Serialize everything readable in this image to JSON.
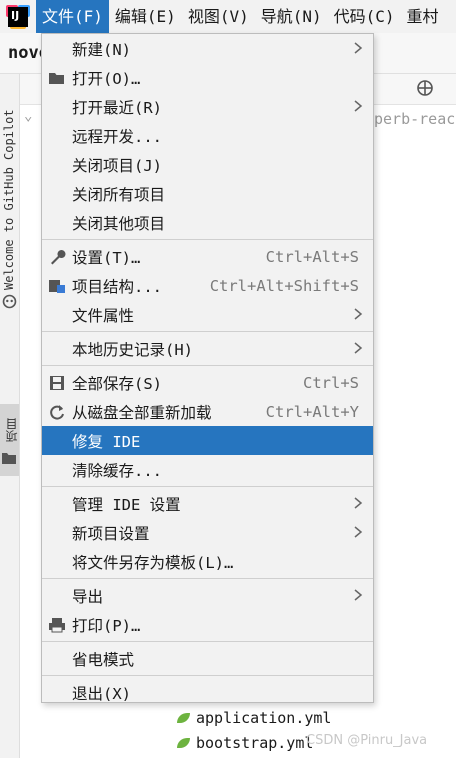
{
  "menubar": {
    "items": [
      "文件(F)",
      "编辑(E)",
      "视图(V)",
      "导航(N)",
      "代码(C)",
      "重村"
    ]
  },
  "navbar": {
    "project": "novo"
  },
  "sidebar": {
    "welcome": "Welcome to GitHub Copilot",
    "project_tab": "项目"
  },
  "editor": {
    "code_fragment": "perb-reac"
  },
  "files": [
    "application.yml",
    "bootstrap.yml"
  ],
  "watermark": "CSDN @Pinru_Java",
  "file_menu": {
    "groups": [
      [
        {
          "label": "新建(N)",
          "shortcut": "",
          "submenu": true,
          "icon": ""
        },
        {
          "label": "打开(O)…",
          "shortcut": "",
          "submenu": false,
          "icon": "folder-icon"
        },
        {
          "label": "打开最近(R)",
          "shortcut": "",
          "submenu": true,
          "icon": ""
        },
        {
          "label": "远程开发...",
          "shortcut": "",
          "submenu": false,
          "icon": ""
        },
        {
          "label": "关闭项目(J)",
          "shortcut": "",
          "submenu": false,
          "icon": ""
        },
        {
          "label": "关闭所有项目",
          "shortcut": "",
          "submenu": false,
          "icon": ""
        },
        {
          "label": "关闭其他项目",
          "shortcut": "",
          "submenu": false,
          "icon": ""
        }
      ],
      [
        {
          "label": "设置(T)…",
          "shortcut": "Ctrl+Alt+S",
          "submenu": false,
          "icon": "wrench-icon"
        },
        {
          "label": "项目结构...",
          "shortcut": "Ctrl+Alt+Shift+S",
          "submenu": false,
          "icon": "project-structure-icon"
        },
        {
          "label": "文件属性",
          "shortcut": "",
          "submenu": true,
          "icon": ""
        }
      ],
      [
        {
          "label": "本地历史记录(H)",
          "shortcut": "",
          "submenu": true,
          "icon": ""
        }
      ],
      [
        {
          "label": "全部保存(S)",
          "shortcut": "Ctrl+S",
          "submenu": false,
          "icon": "save-icon"
        },
        {
          "label": "从磁盘全部重新加载",
          "shortcut": "Ctrl+Alt+Y",
          "submenu": false,
          "icon": "reload-icon"
        },
        {
          "label": "修复 IDE",
          "shortcut": "",
          "submenu": false,
          "icon": "",
          "highlighted": true
        },
        {
          "label": "清除缓存...",
          "shortcut": "",
          "submenu": false,
          "icon": ""
        }
      ],
      [
        {
          "label": "管理 IDE 设置",
          "shortcut": "",
          "submenu": true,
          "icon": ""
        },
        {
          "label": "新项目设置",
          "shortcut": "",
          "submenu": true,
          "icon": ""
        },
        {
          "label": "将文件另存为模板(L)…",
          "shortcut": "",
          "submenu": false,
          "icon": ""
        }
      ],
      [
        {
          "label": "导出",
          "shortcut": "",
          "submenu": true,
          "icon": ""
        },
        {
          "label": "打印(P)…",
          "shortcut": "",
          "submenu": false,
          "icon": "print-icon"
        }
      ],
      [
        {
          "label": "省电模式",
          "shortcut": "",
          "submenu": false,
          "icon": ""
        }
      ],
      [
        {
          "label": "退出(X)",
          "shortcut": "",
          "submenu": false,
          "icon": ""
        }
      ]
    ]
  }
}
